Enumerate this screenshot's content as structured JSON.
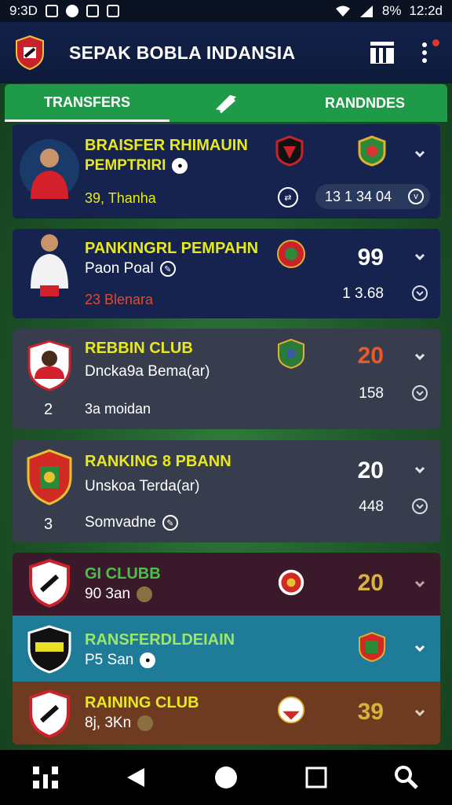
{
  "status_bar": {
    "time_left": "9:3D",
    "battery": "8%",
    "clock": "12:2d"
  },
  "header": {
    "title": "SEPAK BOBLA INDANSIA"
  },
  "tabs": {
    "left": "TRANSFERS",
    "right": "RANDNDES"
  },
  "cards": [
    {
      "line1": "BRAISFER RHIMAUIN",
      "line2": "PEMPTRIRI",
      "line3": "39, Thanha",
      "badge_pill": "13 1 34 04",
      "bg": "#16234f"
    },
    {
      "line1": "PANKINGRL PEMPAHN",
      "line2": "Paon Poal",
      "line3": "23 Blenara",
      "score": "99",
      "sub": "1 3.68",
      "bg": "#16234f"
    },
    {
      "line1": "REBBIN CLUB",
      "line2": "Dncka9a Bema(ar)",
      "line3": "3a moidan",
      "rank": "2",
      "score": "20",
      "sub": "158",
      "bg": "#373d4c"
    },
    {
      "line1": "RANKING 8 PBANN",
      "line2": "Unskoa Terda(ar)",
      "line3": "Somvadne",
      "rank": "3",
      "score": "20",
      "sub": "448",
      "bg": "#373d4c"
    },
    {
      "line1": "GI CLUBB",
      "line2": "90 3an",
      "score": "20",
      "bg": "#3a1a2a"
    },
    {
      "line1": "RANSFERDLDEIAIN",
      "line2": "P5 San",
      "bg": "#1f7c98"
    },
    {
      "line1": "RAINING CLUB",
      "line2": "8j, 3Kn",
      "score": "39",
      "bg": "#6e3a20"
    }
  ],
  "colors": {
    "accent_green": "#1f9a48",
    "yellow_text": "#e8e81e",
    "red_text": "#e24a2a",
    "score_orange": "#e85a2a",
    "score_gold": "#d7b33a"
  }
}
